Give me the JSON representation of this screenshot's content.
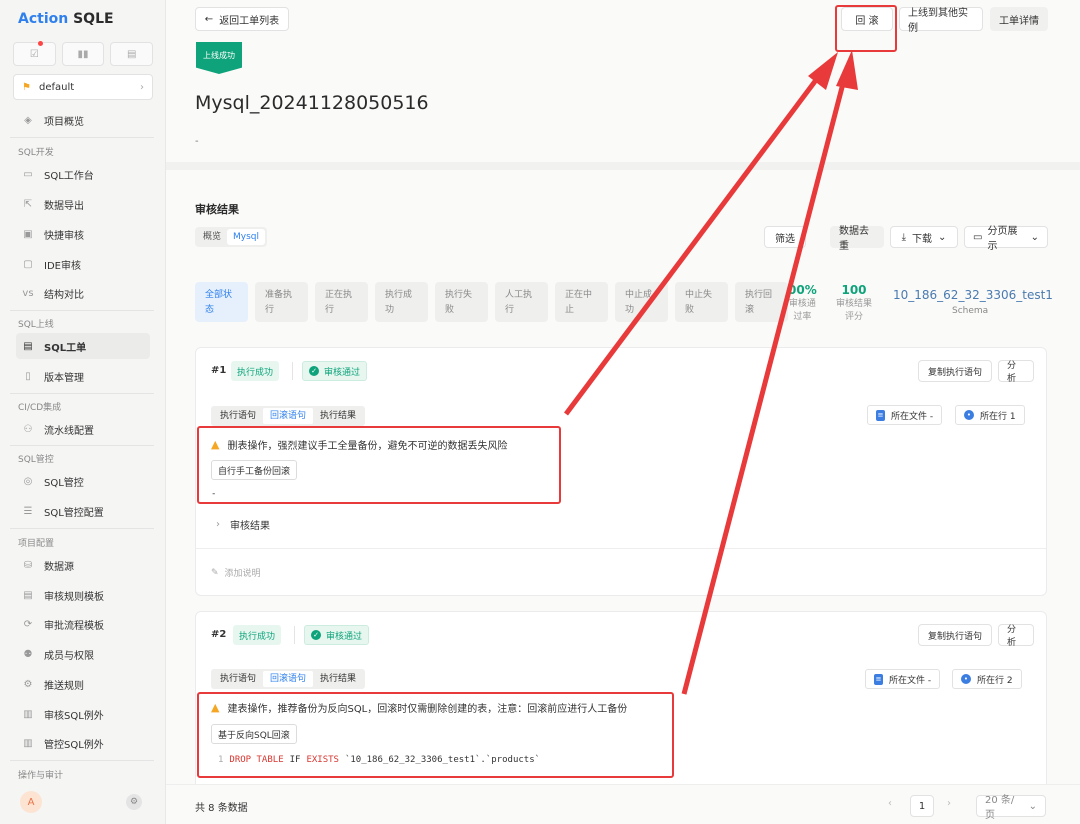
{
  "app": {
    "logo_a": "Action",
    "logo_b": "SQLE"
  },
  "project": {
    "name": "default"
  },
  "sidebar": {
    "overview": "项目概览",
    "groups": [
      "SQL开发",
      "SQL上线",
      "CI/CD集成",
      "SQL管控",
      "项目配置",
      "操作与审计"
    ],
    "items": [
      "SQL工作台",
      "数据导出",
      "快捷审核",
      "IDE审核",
      "结构对比",
      "SQL工单",
      "版本管理",
      "流水线配置",
      "SQL管控",
      "SQL管控配置",
      "数据源",
      "审核规则模板",
      "审批流程模板",
      "成员与权限",
      "推送规则",
      "审核SQL例外",
      "管控SQL例外"
    ],
    "avatar": "A"
  },
  "header": {
    "back": "返回工单列表",
    "rollback": "回 滚",
    "deploy_other": "上线到其他实例",
    "details": "工单详情"
  },
  "order": {
    "status_ribbon": "上线成功",
    "title": "Mysql_20241128050516",
    "desc": "-"
  },
  "review": {
    "heading": "审核结果",
    "tabs": [
      "概览",
      "Mysql"
    ],
    "filter_btn": "筛选",
    "dedupe_btn": "数据去重",
    "download_btn": "下载",
    "paging_btn": "分页展示",
    "filters": [
      [
        "全部状",
        "态"
      ],
      [
        "准备执",
        "行"
      ],
      [
        "正在执",
        "行"
      ],
      [
        "执行成",
        "功"
      ],
      [
        "执行失",
        "败"
      ],
      [
        "人工执",
        "行"
      ],
      [
        "正在中",
        "止"
      ],
      [
        "中止成",
        "功"
      ],
      [
        "中止失",
        "败"
      ],
      [
        "执行回",
        "滚"
      ]
    ],
    "pass_rate": "00%",
    "pass_rate_label1": "审核通",
    "pass_rate_label2": "过率",
    "score": "100",
    "score_label1": "审核结果",
    "score_label2": "评分",
    "schema": "10_186_62_32_3306_test1",
    "schema_label": "Schema"
  },
  "cards": [
    {
      "num": "#1",
      "status": "执行成功",
      "audit": "审核通过",
      "copy": "复制执行语句",
      "analyze": "分 析",
      "tabs": [
        "执行语句",
        "回滚语句",
        "执行结果"
      ],
      "file": "所在文件 -",
      "line": "所在行 1",
      "warning": "删表操作，强烈建议手工全量备份，避免不可逆的数据丢失风险",
      "action": "自行手工备份回滚",
      "code": "-",
      "result_label": "审核结果",
      "note": "添加说明"
    },
    {
      "num": "#2",
      "status": "执行成功",
      "audit": "审核通过",
      "copy": "复制执行语句",
      "analyze": "分 析",
      "tabs": [
        "执行语句",
        "回滚语句",
        "执行结果"
      ],
      "file": "所在文件 -",
      "line": "所在行 2",
      "warning": "建表操作，推荐备份为反向SQL，回滚时仅需删除创建的表，注意：回滚前应进行人工备份",
      "action": "基于反向SQL回滚",
      "code_ln": "1",
      "code_kw1": "DROP TABLE",
      "code_mid": "IF",
      "code_kw2": "EXISTS",
      "code_rest": "`10_186_62_32_3306_test1`.`products`"
    }
  ],
  "pager": {
    "total": "共 8 条数据",
    "page": "1",
    "size": "20 条/页"
  },
  "colors": {
    "accent": "#2f80ed",
    "success": "#0ea37a",
    "annotation": "#e83a3a"
  }
}
